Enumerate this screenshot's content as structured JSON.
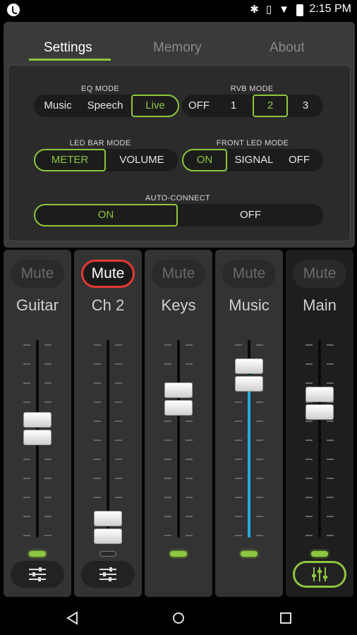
{
  "status_bar": {
    "time": "2:15 PM",
    "icons": [
      "bluetooth-icon",
      "vibrate-icon",
      "wifi-icon",
      "battery-icon"
    ]
  },
  "tabs": [
    {
      "label": "Settings",
      "active": true
    },
    {
      "label": "Memory",
      "active": false
    },
    {
      "label": "About",
      "active": false
    }
  ],
  "settings": {
    "eq_mode": {
      "label": "EQ MODE",
      "options": [
        "Music",
        "Speech",
        "Live"
      ],
      "selected": "Live"
    },
    "rvb_mode": {
      "label": "RVB MODE",
      "options": [
        "OFF",
        "1",
        "2",
        "3"
      ],
      "selected": "2"
    },
    "led_bar_mode": {
      "label": "LED BAR MODE",
      "options": [
        "METER",
        "VOLUME"
      ],
      "selected": "METER"
    },
    "front_led_mode": {
      "label": "FRONT LED MODE",
      "options": [
        "ON",
        "SIGNAL",
        "OFF"
      ],
      "selected": "ON"
    },
    "auto_connect": {
      "label": "AUTO-CONNECT",
      "options": [
        "ON",
        "OFF"
      ],
      "selected": "ON"
    }
  },
  "channels": [
    {
      "name": "Guitar",
      "mute_label": "Mute",
      "muted": false,
      "level": 0.55,
      "fill_color": "",
      "led": "green",
      "has_control": true,
      "control_active": false
    },
    {
      "name": "Ch 2",
      "mute_label": "Mute",
      "muted": true,
      "level": 0.05,
      "fill_color": "",
      "led": "off",
      "has_control": true,
      "control_active": false
    },
    {
      "name": "Keys",
      "mute_label": "Mute",
      "muted": false,
      "level": 0.7,
      "fill_color": "",
      "led": "green",
      "has_control": false,
      "control_active": false
    },
    {
      "name": "Music",
      "mute_label": "Mute",
      "muted": false,
      "level": 0.82,
      "fill_color": "#29a8e0",
      "led": "green",
      "has_control": false,
      "control_active": false
    },
    {
      "name": "Main",
      "mute_label": "Mute",
      "muted": false,
      "level": 0.68,
      "fill_color": "",
      "led": "green",
      "has_control": true,
      "control_active": true
    }
  ],
  "colors": {
    "accent": "#8dc63f",
    "mute_red": "#e53935",
    "music_fill": "#29a8e0"
  },
  "nav": [
    "back-icon",
    "home-icon",
    "recents-icon"
  ]
}
